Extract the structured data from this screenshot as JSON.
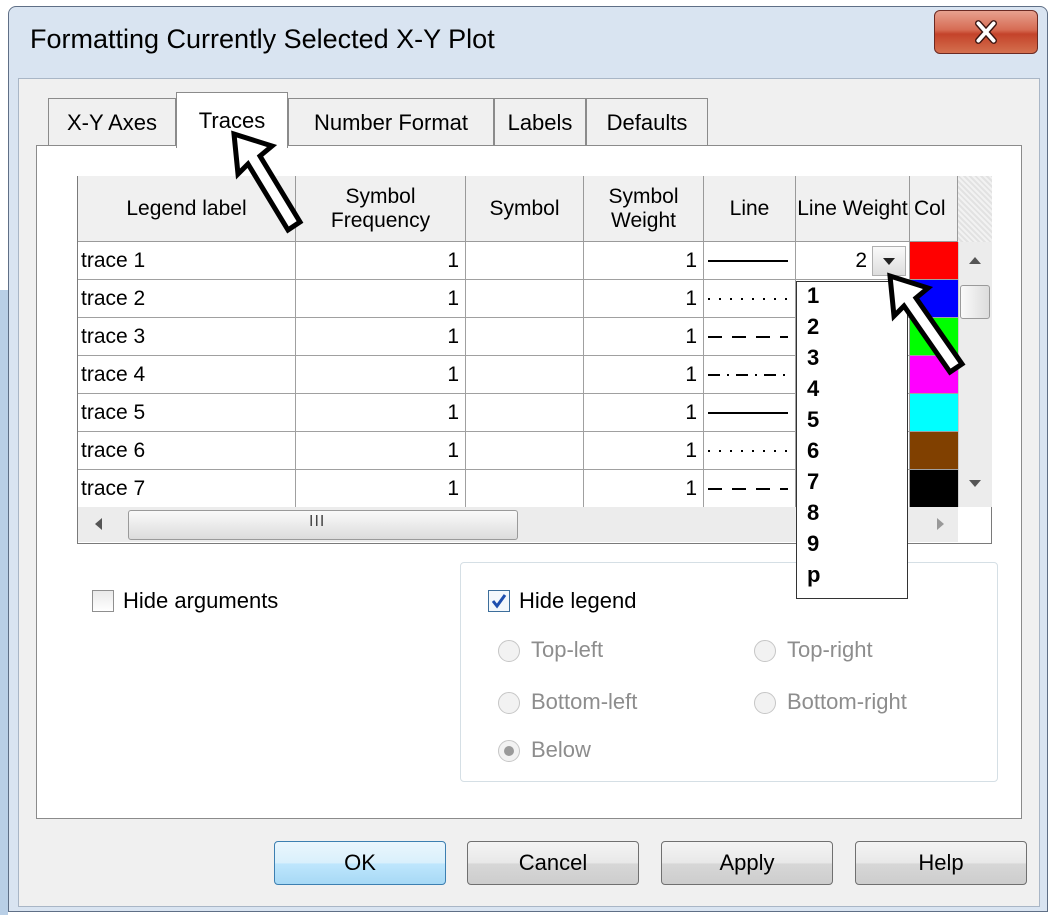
{
  "window": {
    "title": "Formatting Currently Selected X-Y Plot",
    "close_icon": "close-x-icon"
  },
  "tabs": [
    {
      "label": "X-Y Axes"
    },
    {
      "label": "Traces",
      "selected": true
    },
    {
      "label": "Number Format"
    },
    {
      "label": "Labels"
    },
    {
      "label": "Defaults"
    }
  ],
  "grid": {
    "columns": [
      {
        "label": "Legend label"
      },
      {
        "label": "Symbol Frequency"
      },
      {
        "label": "Symbol"
      },
      {
        "label": "Symbol Weight"
      },
      {
        "label": "Line"
      },
      {
        "label": "Line Weight"
      },
      {
        "label": "Col"
      }
    ],
    "rows": [
      {
        "legend_label": "trace 1",
        "symbol_frequency": "1",
        "symbol": "",
        "symbol_weight": "1",
        "line_style": "solid",
        "line_weight": "2",
        "color": "#ff0000"
      },
      {
        "legend_label": "trace 2",
        "symbol_frequency": "1",
        "symbol": "",
        "symbol_weight": "1",
        "line_style": "dotted",
        "line_weight": "",
        "color": "#0000ff"
      },
      {
        "legend_label": "trace 3",
        "symbol_frequency": "1",
        "symbol": "",
        "symbol_weight": "1",
        "line_style": "dashed",
        "line_weight": "",
        "color": "#00ff00"
      },
      {
        "legend_label": "trace 4",
        "symbol_frequency": "1",
        "symbol": "",
        "symbol_weight": "1",
        "line_style": "dash-dot",
        "line_weight": "",
        "color": "#ff00ff"
      },
      {
        "legend_label": "trace 5",
        "symbol_frequency": "1",
        "symbol": "",
        "symbol_weight": "1",
        "line_style": "solid",
        "line_weight": "",
        "color": "#00ffff"
      },
      {
        "legend_label": "trace 6",
        "symbol_frequency": "1",
        "symbol": "",
        "symbol_weight": "1",
        "line_style": "dotted",
        "line_weight": "",
        "color": "#804000"
      },
      {
        "legend_label": "trace 7",
        "symbol_frequency": "1",
        "symbol": "",
        "symbol_weight": "1",
        "line_style": "dashed",
        "line_weight": "",
        "color": "#000000"
      }
    ],
    "hscroll_grip": "III"
  },
  "line_weight_dropdown": {
    "selected": "2",
    "options": [
      "1",
      "2",
      "3",
      "4",
      "5",
      "6",
      "7",
      "8",
      "9",
      "p"
    ]
  },
  "hide_arguments": {
    "label": "Hide arguments",
    "checked": false
  },
  "legend": {
    "hide_legend": {
      "label": "Hide legend",
      "checked": true
    },
    "positions": [
      {
        "label": "Top-left",
        "selected": false
      },
      {
        "label": "Top-right",
        "selected": false
      },
      {
        "label": "Bottom-left",
        "selected": false
      },
      {
        "label": "Bottom-right",
        "selected": false
      },
      {
        "label": "Below",
        "selected": true
      }
    ]
  },
  "buttons": {
    "ok": "OK",
    "cancel": "Cancel",
    "apply": "Apply",
    "help": "Help"
  },
  "annotations": [
    {
      "target": "tab-traces",
      "icon": "outline-arrow-icon"
    },
    {
      "target": "line-weight-dropdown",
      "icon": "outline-arrow-icon"
    }
  ]
}
